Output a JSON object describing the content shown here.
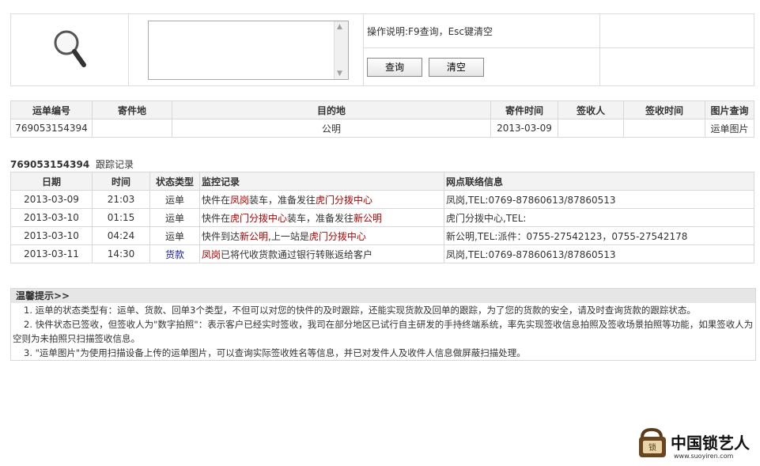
{
  "query": {
    "instructions": "操作说明:F9查询，Esc键清空",
    "query_button": "查询",
    "clear_button": "清空",
    "input_value": ""
  },
  "waybill": {
    "headers": [
      "运单编号",
      "寄件地",
      "目的地",
      "寄件时间",
      "签收人",
      "签收时间",
      "图片查询"
    ],
    "row": {
      "number": "769053154394",
      "origin": "",
      "destination": "公明",
      "send_time": "2013-03-09",
      "signer": "",
      "sign_time": "",
      "image_link": "运单图片"
    }
  },
  "tracking": {
    "waybill_number": "769053154394",
    "title_suffix": "跟踪记录",
    "headers": [
      "日期",
      "时间",
      "状态类型",
      "监控记录",
      "网点联络信息"
    ],
    "rows": [
      {
        "date": "2013-03-09",
        "time": "21:03",
        "type": "运单",
        "record": [
          {
            "t": "快件在",
            "c": ""
          },
          {
            "t": "凤岗",
            "c": "red"
          },
          {
            "t": "装车，准备发往",
            "c": ""
          },
          {
            "t": "虎门分拨中心",
            "c": "red"
          }
        ],
        "contact": "凤岗,TEL:0769-87860613/87860513"
      },
      {
        "date": "2013-03-10",
        "time": "01:15",
        "type": "运单",
        "record": [
          {
            "t": "快件在",
            "c": ""
          },
          {
            "t": "虎门分拨中心",
            "c": "red"
          },
          {
            "t": "装车，准备发往",
            "c": ""
          },
          {
            "t": "新公明",
            "c": "red"
          }
        ],
        "contact": "虎门分拨中心,TEL:"
      },
      {
        "date": "2013-03-10",
        "time": "04:24",
        "type": "运单",
        "record": [
          {
            "t": "快件到达",
            "c": ""
          },
          {
            "t": "新公明",
            "c": "red"
          },
          {
            "t": ",上一站是",
            "c": ""
          },
          {
            "t": "虎门分拨中心",
            "c": "red"
          }
        ],
        "contact": "新公明,TEL:派件：0755-27542123，0755-27542178"
      },
      {
        "date": "2013-03-11",
        "time": "14:30",
        "type": "货款",
        "type_color": "blue",
        "record": [
          {
            "t": "凤岗",
            "c": "red"
          },
          {
            "t": "已将代收货款通过银行转账返给客户",
            "c": ""
          }
        ],
        "contact": "凤岗,TEL:0769-87860613/87860513"
      }
    ]
  },
  "tips": {
    "heading": "温馨提示>>",
    "items": [
      "1. 运单的状态类型有：运单、货款、回单3个类型，不但可以对您的快件的及时跟踪，还能实现货款及回单的跟踪，为了您的货款的安全，请及时查询货款的跟踪状态。",
      "2. 快件状态已签收，但签收人为\"数字拍照\"：表示客户已经实时签收，我司在部分地区已试行自主研发的手持终端系统，率先实现签收信息拍照及签收场景拍照等功能，如果签收人为空则为未拍照只扫描签收信息。",
      "3. \"运单图片\"为使用扫描设备上传的运单图片，可以查询实际签收姓名等信息，并已对发件人及收件人信息做屏蔽扫描处理。"
    ]
  },
  "logo": {
    "seal_text": "锁",
    "brand_text": "中国锁艺人",
    "url_text": "www.suoyiren.com"
  }
}
